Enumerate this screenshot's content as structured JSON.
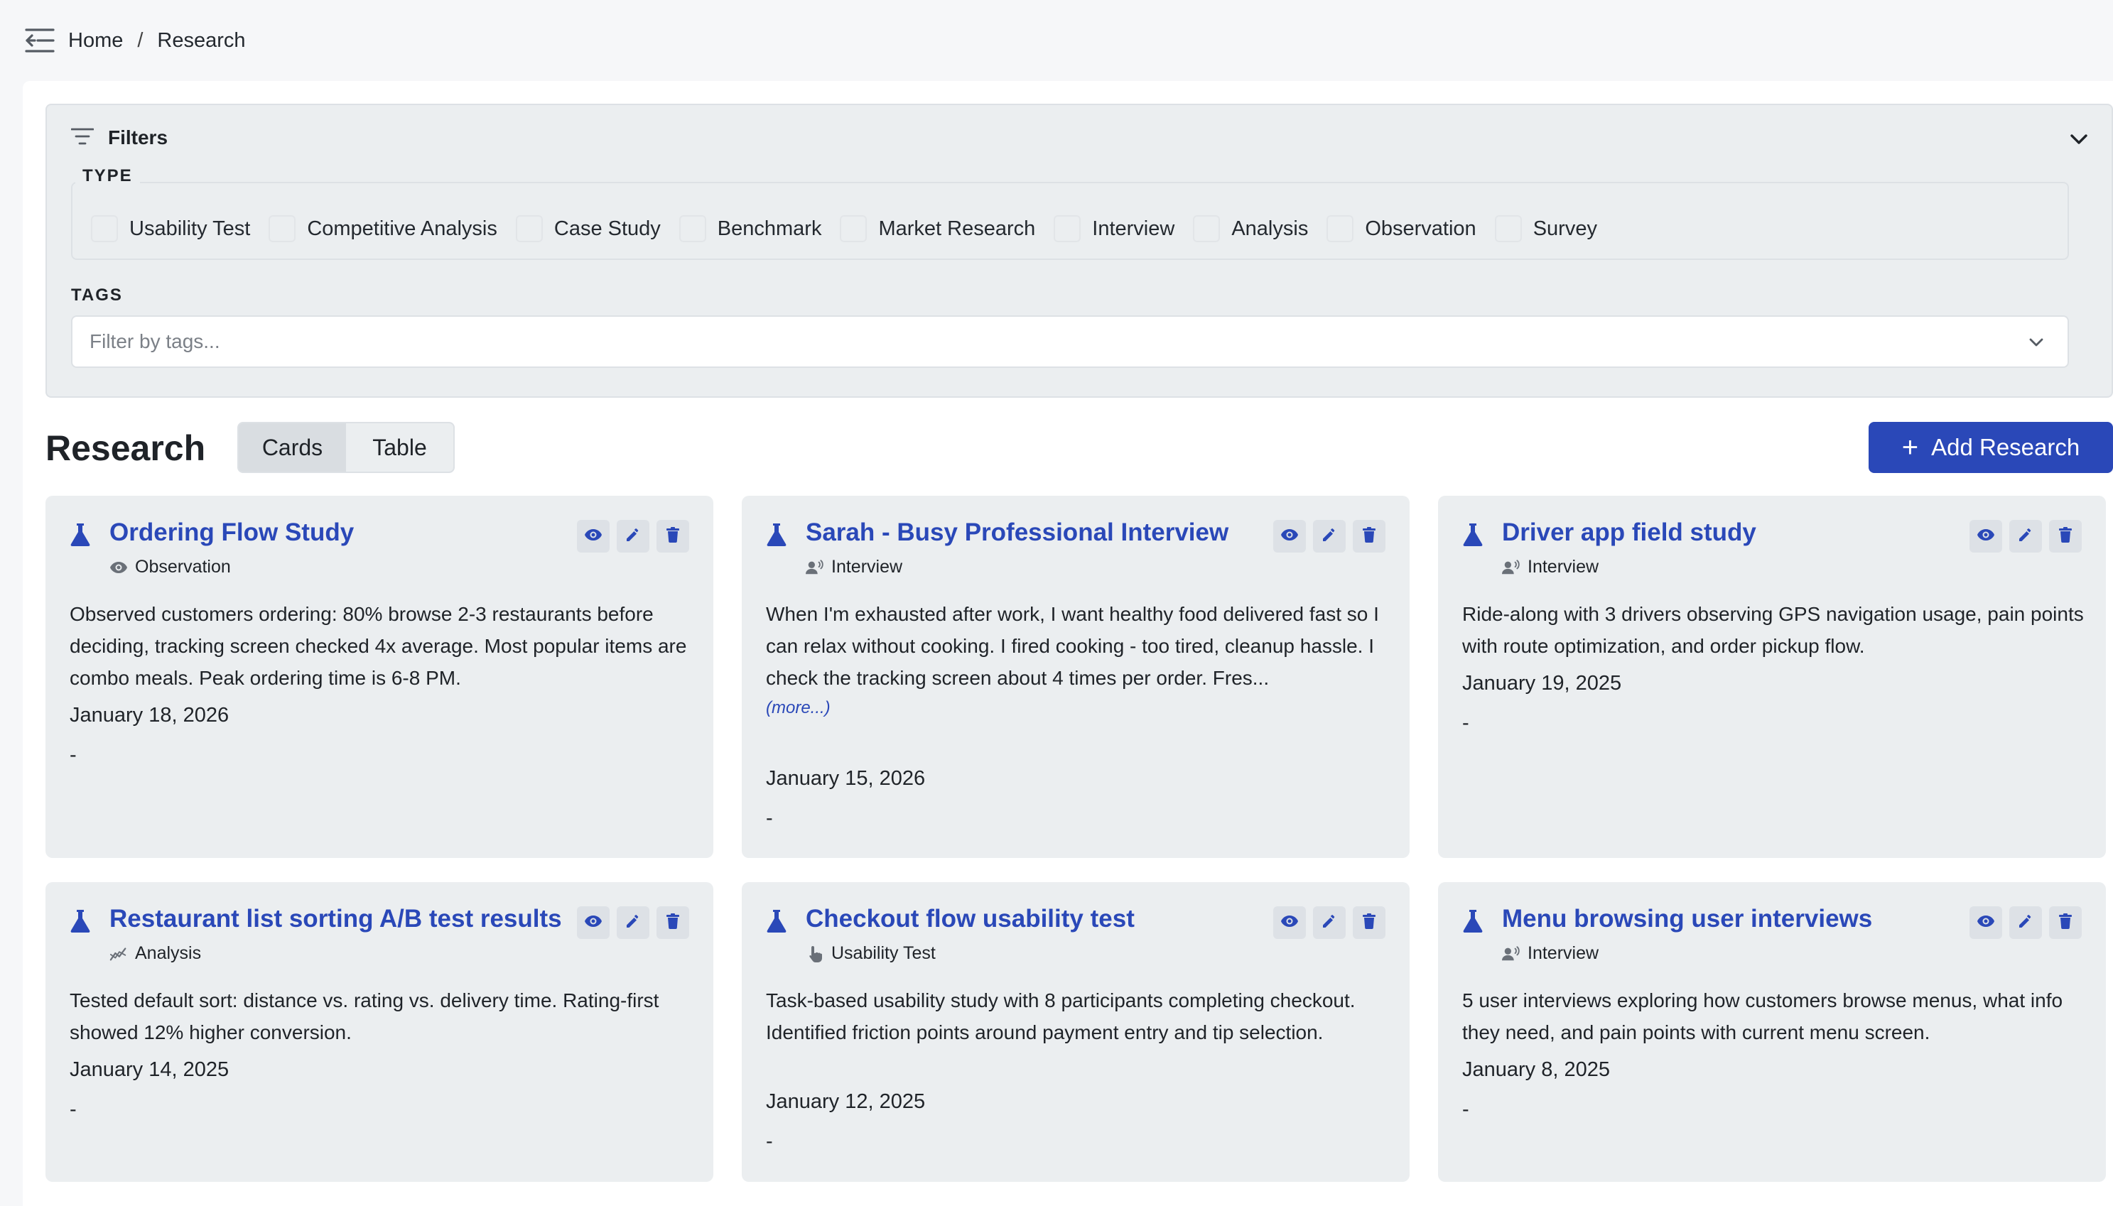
{
  "breadcrumb": {
    "home": "Home",
    "separator": "/",
    "current": "Research"
  },
  "icons": {
    "sidebar_toggle": "sidebar-toggle-icon",
    "filter": "filter-lines-icon",
    "chevron": "chevron-down-icon"
  },
  "filters": {
    "title": "Filters",
    "type_label": "TYPE",
    "types": [
      "Usability Test",
      "Competitive Analysis",
      "Case Study",
      "Benchmark",
      "Market Research",
      "Interview",
      "Analysis",
      "Observation",
      "Survey"
    ],
    "tags_label": "TAGS",
    "tags_placeholder": "Filter by tags..."
  },
  "research": {
    "title": "Research",
    "views": {
      "cards": "Cards",
      "table": "Table",
      "active": "Cards"
    },
    "add_button": "Add Research",
    "add_icon": "+"
  },
  "colors": {
    "accent": "#2a48b8",
    "card_bg": "#ebeef0",
    "panel_bg": "#ffffff",
    "page_bg": "#f6f7f9"
  },
  "cards": [
    {
      "title": "Ordering Flow Study",
      "type": "Observation",
      "type_icon": "eye-icon",
      "description": "Observed customers ordering: 80% browse 2-3 restaurants before deciding, tracking screen checked 4x average. Most popular items are combo meals. Peak ordering time is 6-8 PM.",
      "more": "",
      "date": "January 18, 2026",
      "tags": "-"
    },
    {
      "title": "Sarah - Busy Professional Interview",
      "type": "Interview",
      "type_icon": "people-speaking-icon",
      "description": "When I'm exhausted after work, I want healthy food delivered fast so I can relax without cooking. I fired cooking - too tired, cleanup hassle. I check the tracking screen about 4 times per order. Fres...",
      "more": "(more...)",
      "date": "January 15, 2026",
      "tags": "-"
    },
    {
      "title": "Driver app field study",
      "type": "Interview",
      "type_icon": "people-speaking-icon",
      "description": "Ride-along with 3 drivers observing GPS navigation usage, pain points with route optimization, and order pickup flow.",
      "more": "",
      "date": "January 19, 2025",
      "tags": "-"
    },
    {
      "title": "Restaurant list sorting A/B test results",
      "type": "Analysis",
      "type_icon": "analytics-icon",
      "description": "Tested default sort: distance vs. rating vs. delivery time. Rating-first showed 12% higher conversion.",
      "more": "",
      "date": "January 14, 2025",
      "tags": "-"
    },
    {
      "title": "Checkout flow usability test",
      "type": "Usability Test",
      "type_icon": "pointer-hand-icon",
      "description": "Task-based usability study with 8 participants completing checkout. Identified friction points around payment entry and tip selection.",
      "more": "",
      "date": "January 12, 2025",
      "tags": "-"
    },
    {
      "title": "Menu browsing user interviews",
      "type": "Interview",
      "type_icon": "people-speaking-icon",
      "description": "5 user interviews exploring how customers browse menus, what info they need, and pain points with current menu screen.",
      "more": "",
      "date": "January 8, 2025",
      "tags": "-"
    }
  ]
}
